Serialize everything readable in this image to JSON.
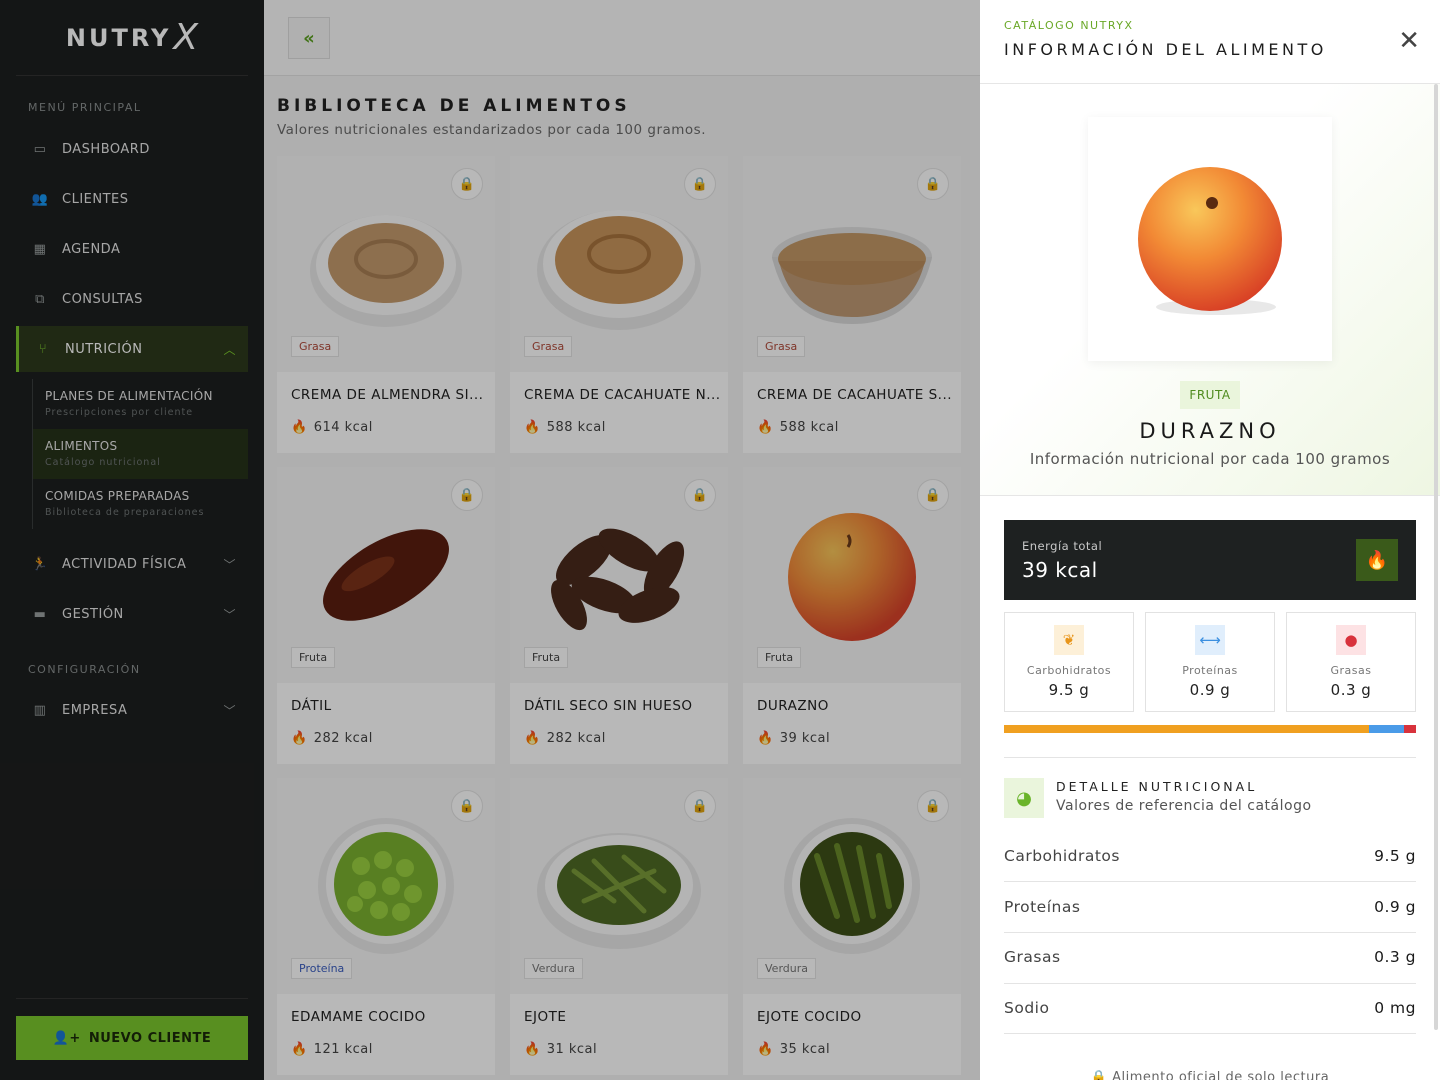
{
  "brand": {
    "name": "NUTRY",
    "mark": "X"
  },
  "sidebar": {
    "main_label": "MENÚ PRINCIPAL",
    "items": [
      {
        "label": "DASHBOARD",
        "icon": "layout-icon"
      },
      {
        "label": "CLIENTES",
        "icon": "users-icon"
      },
      {
        "label": "AGENDA",
        "icon": "calendar-icon"
      },
      {
        "label": "CONSULTAS",
        "icon": "consult-icon"
      },
      {
        "label": "NUTRICIÓN",
        "icon": "utensils-icon"
      },
      {
        "label": "ACTIVIDAD FÍSICA",
        "icon": "running-icon"
      },
      {
        "label": "GESTIÓN",
        "icon": "briefcase-icon"
      }
    ],
    "submenu": [
      {
        "title": "PLANES DE ALIMENTACIÓN",
        "subtitle": "Prescripciones por cliente"
      },
      {
        "title": "ALIMENTOS",
        "subtitle": "Catálogo nutricional"
      },
      {
        "title": "COMIDAS PREPARADAS",
        "subtitle": "Biblioteca de preparaciones"
      }
    ],
    "config_label": "CONFIGURACIÓN",
    "config_items": [
      {
        "label": "EMPRESA",
        "icon": "building-icon"
      }
    ],
    "new_client_label": "NUEVO CLIENTE"
  },
  "library": {
    "title": "BIBLIOTECA DE ALIMENTOS",
    "subtitle": "Valores nutricionales estandarizados por cada 100 gramos.",
    "cards": [
      {
        "tag": "Grasa",
        "name": "CREMA DE ALMENDRA SI...",
        "kcal": "614 kcal"
      },
      {
        "tag": "Grasa",
        "name": "CREMA DE CACAHUATE N...",
        "kcal": "588 kcal"
      },
      {
        "tag": "Grasa",
        "name": "CREMA DE CACAHUATE S...",
        "kcal": "588 kcal"
      },
      {
        "tag": "Fruta",
        "name": "DÁTIL",
        "kcal": "282 kcal"
      },
      {
        "tag": "Fruta",
        "name": "DÁTIL SECO SIN HUESO",
        "kcal": "282 kcal"
      },
      {
        "tag": "Fruta",
        "name": "DURAZNO",
        "kcal": "39 kcal"
      },
      {
        "tag": "Proteína",
        "name": "EDAMAME COCIDO",
        "kcal": "121 kcal"
      },
      {
        "tag": "Verdura",
        "name": "EJOTE",
        "kcal": "31 kcal"
      },
      {
        "tag": "Verdura",
        "name": "EJOTE COCIDO",
        "kcal": "35 kcal"
      }
    ]
  },
  "panel": {
    "eyebrow": "CATÁLOGO NUTRYX",
    "title": "INFORMACIÓN DEL ALIMENTO",
    "category": "FRUTA",
    "food_name": "DURAZNO",
    "food_desc": "Información nutricional por cada 100 gramos",
    "energy_label": "Energía total",
    "energy_value": "39 kcal",
    "macros": [
      {
        "label": "Carbohidratos",
        "value": "9.5 g",
        "icon": "wheat-icon",
        "color": "#f0a020"
      },
      {
        "label": "Proteínas",
        "value": "0.9 g",
        "icon": "dumbbell-icon",
        "color": "#3b8fe0"
      },
      {
        "label": "Grasas",
        "value": "0.3 g",
        "icon": "drop-icon",
        "color": "#d8323c"
      }
    ],
    "macro_bar": [
      {
        "share": 0.887,
        "color": "#f0a020"
      },
      {
        "share": 0.084,
        "color": "#4a9be8"
      },
      {
        "share": 0.029,
        "color": "#d8323c"
      }
    ],
    "detail_title": "DETALLE NUTRICIONAL",
    "detail_sub": "Valores de referencia del catálogo",
    "rows": [
      {
        "k": "Carbohidratos",
        "v": "9.5 g"
      },
      {
        "k": "Proteínas",
        "v": "0.9 g"
      },
      {
        "k": "Grasas",
        "v": "0.3 g"
      },
      {
        "k": "Sodio",
        "v": "0 mg"
      }
    ],
    "footer": "Alimento oficial de solo lectura"
  }
}
